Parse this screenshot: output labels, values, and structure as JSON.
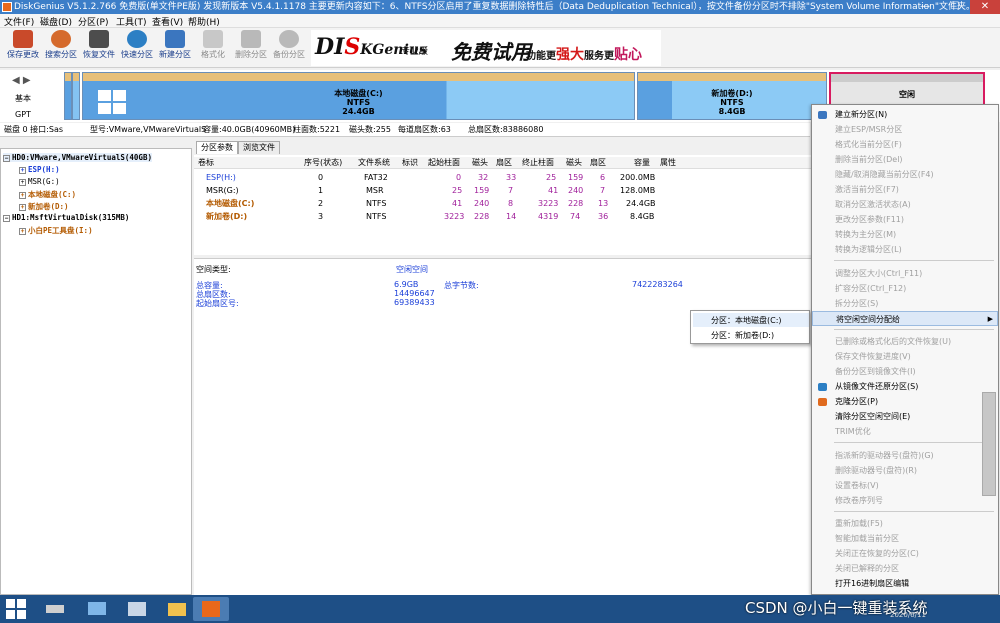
{
  "window": {
    "title": "DiskGenius V5.1.2.766 免费版(单文件PE版)   发现新版本 V5.4.1.1178 主要更新内容如下：6、NTFS分区启用了重复数据删除特性后（Data Deduplication Technical），按文件备份分区时不排除\"System Volume Information\"文件夹。",
    "controls": {
      "minimize": "—",
      "maximize": "☐",
      "close": "✕"
    }
  },
  "menubar": [
    "文件(F)",
    "磁盘(D)",
    "分区(P)",
    "工具(T)",
    "查看(V)",
    "帮助(H)"
  ],
  "toolbar": [
    {
      "label": "保存更改",
      "icon": "save-icon",
      "color": "#c94a2a",
      "disabled": false
    },
    {
      "label": "搜索分区",
      "icon": "search-icon",
      "color": "#d56a2c",
      "disabled": false
    },
    {
      "label": "恢复文件",
      "icon": "recover-icon",
      "color": "#4d4d4d",
      "disabled": false
    },
    {
      "label": "快速分区",
      "icon": "quick-partition-icon",
      "color": "#2c7fc4",
      "disabled": false
    },
    {
      "label": "新建分区",
      "icon": "new-partition-icon",
      "color": "#3b76bf",
      "disabled": false
    },
    {
      "label": "格式化",
      "icon": "format-icon",
      "color": "#9a9a9a",
      "disabled": true
    },
    {
      "label": "删除分区",
      "icon": "delete-icon",
      "color": "#8f8f8f",
      "disabled": true
    },
    {
      "label": "备份分区",
      "icon": "backup-icon",
      "color": "#8f8f8f",
      "disabled": true
    }
  ],
  "banner": {
    "logo_left": "DI",
    "logo_red": "S",
    "logo_right": "KGenius",
    "edition": "专业版",
    "slogan": "免费试用",
    "feature": "功能更",
    "strong": "强大",
    "service": "服务更",
    "intimate": "贴心"
  },
  "diskmap": {
    "nav": "◀ ▶",
    "label_basic": "基本",
    "label_gpt": "GPT",
    "partitions": [
      {
        "name": "本地磁盘(C:)",
        "fs": "NTFS",
        "size": "24.4GB"
      },
      {
        "name": "新加卷(D:)",
        "fs": "NTFS",
        "size": "8.4GB"
      },
      {
        "name": "空闲",
        "fs": "",
        "size": ""
      }
    ]
  },
  "diskinfo": [
    "磁盘 0 接口:Sas",
    "型号:VMware,VMwareVirtualS",
    "容量:40.0GB(40960MB)",
    "柱面数:5221",
    "磁头数:255",
    "每道扇区数:63",
    "总扇区数:83886080"
  ],
  "tree": {
    "hd0": "HD0:VMware,VMwareVirtualS(40GB)",
    "hd0_parts": [
      "ESP(H:)",
      "MSR(G:)",
      "本地磁盘(C:)",
      "新加卷(D:)"
    ],
    "hd1": "HD1:MsftVirtualDisk(315MB)",
    "hd1_parts": [
      "小白PE工具盘(I:)"
    ]
  },
  "tabs": [
    "分区参数",
    "浏览文件"
  ],
  "grid": {
    "headers": [
      "卷标",
      "序号(状态)",
      "文件系统",
      "标识",
      "起始柱面",
      "磁头",
      "扇区",
      "终止柱面",
      "磁头",
      "扇区",
      "容量",
      "属性"
    ],
    "rows": [
      [
        "ESP(H:)",
        "0",
        "FAT32",
        "",
        "0",
        "32",
        "33",
        "25",
        "159",
        "6",
        "200.0MB",
        ""
      ],
      [
        "MSR(G:)",
        "1",
        "MSR",
        "",
        "25",
        "159",
        "7",
        "41",
        "240",
        "7",
        "128.0MB",
        ""
      ],
      [
        "本地磁盘(C:)",
        "2",
        "NTFS",
        "",
        "41",
        "240",
        "8",
        "3223",
        "228",
        "13",
        "24.4GB",
        ""
      ],
      [
        "新加卷(D:)",
        "3",
        "NTFS",
        "",
        "3223",
        "228",
        "14",
        "4319",
        "74",
        "36",
        "8.4GB",
        ""
      ]
    ]
  },
  "props": {
    "type_label": "空间类型:",
    "type_value": "空闲空间",
    "total_label": "总容量:",
    "total_value": "6.9GB",
    "bytes_label": "总字节数:",
    "bytes_value": "7422283264",
    "sectors_label": "总扇区数:",
    "sectors_value": "14496647",
    "start_label": "起始扇区号:",
    "start_value": "69389433"
  },
  "submenu": [
    "分区：本地磁盘(C:)",
    "分区：新加卷(D:)"
  ],
  "context_menu": [
    {
      "label": "建立新分区(N)",
      "disabled": false
    },
    {
      "label": "建立ESP/MSR分区",
      "disabled": true
    },
    {
      "label": "格式化当前分区(F)",
      "disabled": true
    },
    {
      "label": "删除当前分区(Del)",
      "disabled": true
    },
    {
      "label": "隐藏/取消隐藏当前分区(F4)",
      "disabled": true
    },
    {
      "label": "激活当前分区(F7)",
      "disabled": true
    },
    {
      "label": "取消分区激活状态(A)",
      "disabled": true
    },
    {
      "label": "更改分区参数(F11)",
      "disabled": true
    },
    {
      "label": "转换为主分区(M)",
      "disabled": true
    },
    {
      "label": "转换为逻辑分区(L)",
      "disabled": true
    },
    {
      "label": "调整分区大小(Ctrl_F11)",
      "disabled": true
    },
    {
      "label": "扩容分区(Ctrl_F12)",
      "disabled": true
    },
    {
      "label": "拆分分区(S)",
      "disabled": true
    },
    {
      "label": "将空闲空间分配给",
      "disabled": false
    },
    {
      "label": "已删除或格式化后的文件恢复(U)",
      "disabled": true
    },
    {
      "label": "保存文件恢复进度(V)",
      "disabled": true
    },
    {
      "label": "备份分区到镜像文件(I)",
      "disabled": true
    },
    {
      "label": "从镜像文件还原分区(S)",
      "disabled": false
    },
    {
      "label": "克隆分区(P)",
      "disabled": false
    },
    {
      "label": "清除分区空闲空间(E)",
      "disabled": false
    },
    {
      "label": "TRIM优化",
      "disabled": true
    },
    {
      "label": "指派新的驱动器号(盘符)(G)",
      "disabled": true
    },
    {
      "label": "删除驱动器号(盘符)(R)",
      "disabled": true
    },
    {
      "label": "设置卷标(V)",
      "disabled": true
    },
    {
      "label": "修改卷序列号",
      "disabled": true
    },
    {
      "label": "重新加载(F5)",
      "disabled": true
    },
    {
      "label": "智能加载当前分区",
      "disabled": true
    },
    {
      "label": "关闭正在恢复的分区(C)",
      "disabled": true
    },
    {
      "label": "关闭已解释的分区",
      "disabled": true
    },
    {
      "label": "打开16进制扇区编辑",
      "disabled": false
    }
  ],
  "taskbar": {
    "watermark": "CSDN @小白一键重装系统",
    "date": "2020/6/11"
  }
}
